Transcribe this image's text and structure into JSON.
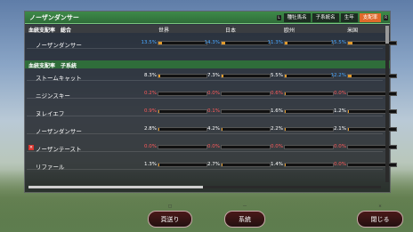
{
  "window_title": "ノーザンダンサー",
  "tabs": [
    {
      "key": "L",
      "label": ""
    },
    {
      "label": "種牡馬名"
    },
    {
      "label": "子系統名"
    },
    {
      "label": "生年"
    },
    {
      "label": "支配率"
    },
    {
      "key": "R",
      "label": ""
    }
  ],
  "header": {
    "label": "血統支配率　総合",
    "columns": [
      "世界",
      "日本",
      "欧州",
      "米国"
    ]
  },
  "total_row": {
    "name": "ノーザンダンサー",
    "values": [
      "13.5%",
      "14.3%",
      "11.3%",
      "15.5%"
    ],
    "fills": [
      0.135,
      0.143,
      0.113,
      0.155
    ]
  },
  "sub_header": {
    "label": "血統支配率　子系統"
  },
  "rows": [
    {
      "name": "ストームキャット",
      "values": [
        "8.3%",
        "7.3%",
        "5.5%",
        "12.2%"
      ],
      "fills": [
        0.083,
        0.073,
        0.055,
        0.122
      ],
      "value_colors": [
        "#ffffff",
        "#ffffff",
        "#ffffff",
        "#49a7ff"
      ]
    },
    {
      "name": "ニジンスキー",
      "values": [
        "0.2%",
        "0.0%",
        "0.6%",
        "0.0%"
      ],
      "fills": [
        0.002,
        0.0,
        0.006,
        0.0
      ],
      "value_colors": [
        "#ff5a5a",
        "#ff5a5a",
        "#ff5a5a",
        "#ff5a5a"
      ]
    },
    {
      "name": "ヌレイエフ",
      "values": [
        "0.9%",
        "0.1%",
        "1.6%",
        "1.2%"
      ],
      "fills": [
        0.009,
        0.001,
        0.016,
        0.012
      ],
      "value_colors": [
        "#ff5a5a",
        "#ff5a5a",
        "#ffffff",
        "#ffffff"
      ]
    },
    {
      "name": "ノーザンダンサー",
      "values": [
        "2.8%",
        "4.2%",
        "2.2%",
        "2.1%"
      ],
      "fills": [
        0.028,
        0.042,
        0.022,
        0.021
      ],
      "value_colors": [
        "#ffffff",
        "#ffffff",
        "#ffffff",
        "#ffffff"
      ]
    },
    {
      "name": "ノーザンテースト",
      "values": [
        "0.0%",
        "0.0%",
        "0.0%",
        "0.0%"
      ],
      "fills": [
        0.0,
        0.0,
        0.0,
        0.0
      ],
      "value_colors": [
        "#ff5a5a",
        "#ff5a5a",
        "#ff5a5a",
        "#ff5a5a"
      ],
      "marker": "×"
    },
    {
      "name": "リファール",
      "values": [
        "1.3%",
        "2.7%",
        "1.4%",
        "0.0%"
      ],
      "fills": [
        0.013,
        0.027,
        0.014,
        0.0
      ],
      "value_colors": [
        "#ffffff",
        "#ffffff",
        "#ffffff",
        "#ff5a5a"
      ]
    }
  ],
  "footer_buttons": [
    {
      "label": "頁送り",
      "icon": "□"
    },
    {
      "label": "系統",
      "icon": "—"
    },
    {
      "label": "閉じる",
      "icon": "×"
    }
  ]
}
